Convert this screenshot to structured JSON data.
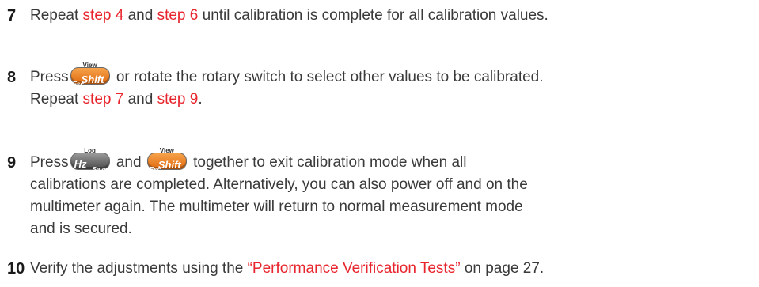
{
  "steps": [
    {
      "number": "7",
      "t1": "Repeat ",
      "link1": "step 4",
      "t2": " and ",
      "link2": "step 6",
      "t3": " until calibration is complete for all calibration values."
    },
    {
      "number": "8",
      "t1": "Press",
      "t2": " or rotate the rotary switch to select other values to be calibrated.",
      "t3": "Repeat ",
      "link1": "step 7",
      "t4": " and ",
      "link2": "step 9",
      "t5": "."
    },
    {
      "number": "9",
      "t1": "Press",
      "t2": " and ",
      "t3": " together to exit calibration mode when all",
      "line2": "calibrations are completed. Alternatively, you can also power off and on the",
      "line3": "multimeter again. The multimeter will return to normal measurement mode",
      "line4": "and is secured."
    },
    {
      "number": "10",
      "t1": "Verify the adjustments using the ",
      "link1": "“Performance Verification Tests”",
      "t2": " on page 27."
    }
  ],
  "keys": {
    "shift": {
      "main": "Shift",
      "sub": "Esc",
      "above": "View",
      "icon": "shift-key-icon"
    },
    "hz": {
      "main": "Hz",
      "sub": "Save",
      "above": "Log",
      "icon": "hz-key-icon"
    }
  },
  "colors": {
    "link": "#e8242d",
    "text": "#3a3a3a",
    "orange_key": "#f08a24",
    "gray_key": "#6e6e6e"
  }
}
